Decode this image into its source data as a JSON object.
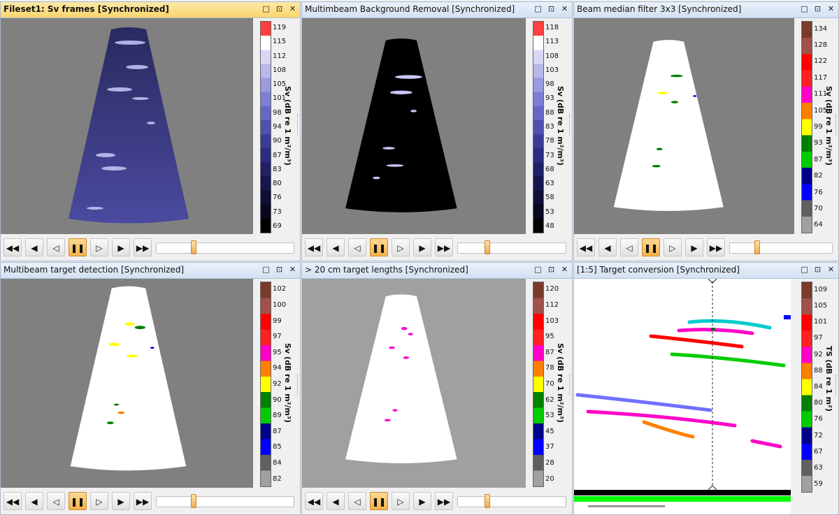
{
  "window_buttons": [
    "□",
    "⊡",
    "✕"
  ],
  "controls": [
    "◀◀",
    "◀",
    "◁",
    "❚❚",
    "▷",
    "▶",
    "▶▶"
  ],
  "panels": [
    {
      "title": "Fileset1: Sv frames [Synchronized]",
      "unit": "Sv (dB re 1 m²/m³)",
      "ticks": [
        "119",
        "115",
        "112",
        "108",
        "105",
        "101",
        "98",
        "94",
        "90",
        "87",
        "83",
        "80",
        "76",
        "73",
        "69"
      ],
      "colors": [
        "#ff4040",
        "#ffffff",
        "#d8d8f4",
        "#b8b8ec",
        "#9a9ae0",
        "#7e7ed4",
        "#6666c4",
        "#5050b0",
        "#3c3c98",
        "#2c2c80",
        "#202066",
        "#16164e",
        "#0e0e36",
        "#08081e",
        "#000000"
      ],
      "slider_position": 0.27
    },
    {
      "title": "Multimbeam Background Removal [Synchronized]",
      "unit": "Sv (dB re 1 m²/m³)",
      "ticks": [
        "118",
        "113",
        "108",
        "103",
        "98",
        "93",
        "88",
        "83",
        "78",
        "73",
        "68",
        "63",
        "58",
        "53",
        "48"
      ],
      "colors": [
        "#ff4040",
        "#ffffff",
        "#d8d8f4",
        "#b8b8ec",
        "#9a9ae0",
        "#7e7ed4",
        "#6666c4",
        "#5050b0",
        "#3c3c98",
        "#2c2c80",
        "#202066",
        "#16164e",
        "#0e0e36",
        "#08081e",
        "#000000"
      ],
      "slider_position": 0.27
    },
    {
      "title": "Beam median filter 3x3 [Synchronized]",
      "unit": "Sv (dB re 1 m²/m³)",
      "ticks": [
        "134",
        "128",
        "122",
        "117",
        "111",
        "105",
        "99",
        "93",
        "87",
        "82",
        "76",
        "70",
        "64"
      ],
      "colors": [
        "#7a3b2a",
        "#a0524a",
        "#ff0000",
        "#ff2020",
        "#ff00c8",
        "#ff8000",
        "#ffff00",
        "#008000",
        "#00cc00",
        "#00008b",
        "#0000ff",
        "#606060",
        "#a0a0a0"
      ],
      "slider_position": 0.27
    },
    {
      "title": "Multibeam target detection [Synchronized]",
      "unit": "Sv (dB re 1 m²/m³)",
      "ticks": [
        "102",
        "100",
        "99",
        "97",
        "95",
        "94",
        "92",
        "90",
        "89",
        "87",
        "85",
        "84",
        "82"
      ],
      "colors": [
        "#7a3b2a",
        "#a0524a",
        "#ff0000",
        "#ff2020",
        "#ff00c8",
        "#ff8000",
        "#ffff00",
        "#008000",
        "#00cc00",
        "#00008b",
        "#0000ff",
        "#606060",
        "#a0a0a0"
      ],
      "slider_position": 0.27
    },
    {
      "title": "> 20 cm target lengths [Synchronized]",
      "unit": "Sv (dB re 1 m²/m³)",
      "ticks": [
        "120",
        "112",
        "103",
        "95",
        "87",
        "78",
        "70",
        "62",
        "53",
        "45",
        "37",
        "28",
        "20"
      ],
      "colors": [
        "#7a3b2a",
        "#a0524a",
        "#ff0000",
        "#ff2020",
        "#ff00c8",
        "#ff8000",
        "#ffff00",
        "#008000",
        "#00cc00",
        "#00008b",
        "#0000ff",
        "#606060",
        "#a0a0a0"
      ],
      "slider_position": 0.27
    },
    {
      "title": "[1:5]  Target conversion [Synchronized]",
      "unit": "TS (dB re 1 m²)",
      "ticks": [
        "109",
        "105",
        "101",
        "97",
        "92",
        "88",
        "84",
        "80",
        "76",
        "72",
        "67",
        "63",
        "59"
      ],
      "colors": [
        "#7a3b2a",
        "#a0524a",
        "#ff0000",
        "#ff2020",
        "#ff00c8",
        "#ff8000",
        "#ffff00",
        "#008000",
        "#00cc00",
        "#00008b",
        "#0000ff",
        "#606060",
        "#a0a0a0"
      ],
      "slider_position": null
    }
  ]
}
